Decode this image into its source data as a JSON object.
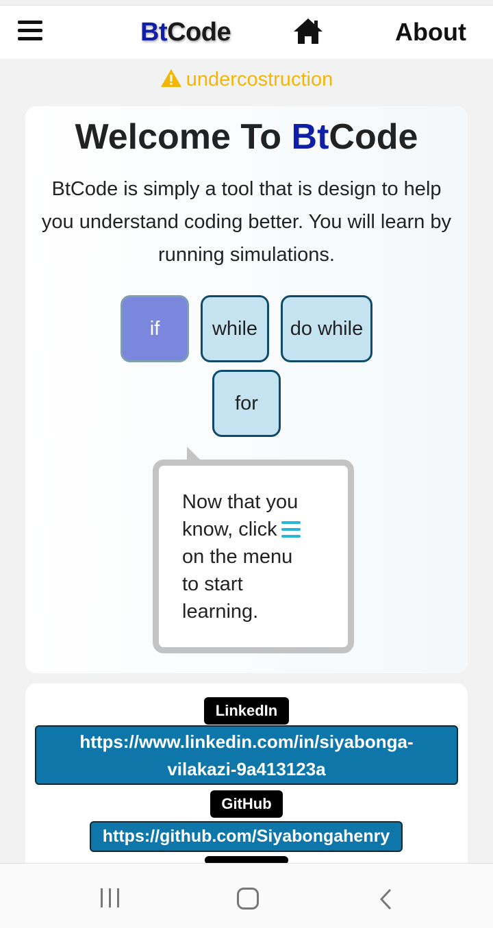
{
  "header": {
    "brand_prefix": "Bt",
    "brand_suffix": "Code",
    "about_label": "About"
  },
  "notice": {
    "text": "undercostruction",
    "color": "#f2b705"
  },
  "welcome": {
    "title_prefix": "Welcome To ",
    "title_brand_prefix": "Bt",
    "title_brand_suffix": "Code",
    "intro": "BtCode is simply a tool that is design to help you understand coding better. You will learn by running simulations."
  },
  "loops": [
    {
      "label": "if",
      "active": true
    },
    {
      "label": "while",
      "active": false
    },
    {
      "label": "do while",
      "active": false
    },
    {
      "label": "for",
      "active": false
    }
  ],
  "tooltip": {
    "line1": "Now that you",
    "line2": "know, click",
    "line3": "on the menu",
    "line4": "to start",
    "line5": "learning."
  },
  "contacts": {
    "linkedin_label": "LinkedIn",
    "linkedin_url_line1": "https://www.linkedin.com/in/siyabonga-",
    "linkedin_url_line2": "vilakazi-9a413123a",
    "github_label": "GitHub",
    "github_url": "https://github.com/Siyabongahenry"
  },
  "colors": {
    "brand_blue": "#0f1fa8",
    "active_button": "#7b86dd",
    "inactive_button": "#c6e3f1",
    "link_blue": "#0e76a8"
  }
}
